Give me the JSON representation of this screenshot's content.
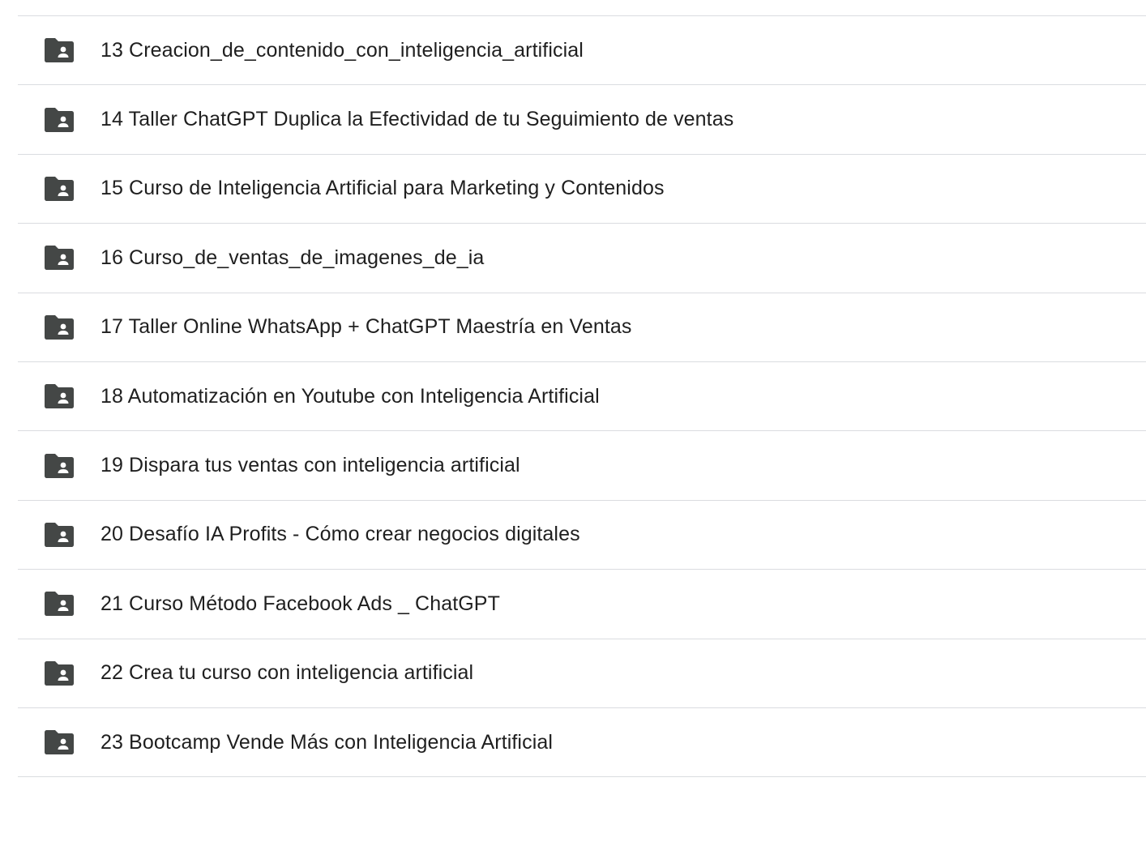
{
  "icons": {
    "folder": "shared-folder-icon"
  },
  "colors": {
    "icon": "#444746",
    "text": "#1f1f1f",
    "divider": "#dadce0"
  },
  "folders": [
    {
      "name": "13 Creacion_de_contenido_con_inteligencia_artificial"
    },
    {
      "name": "14 Taller ChatGPT Duplica la Efectividad de tu Seguimiento de ventas"
    },
    {
      "name": "15 Curso de Inteligencia Artificial para Marketing y Contenidos"
    },
    {
      "name": "16 Curso_de_ventas_de_imagenes_de_ia"
    },
    {
      "name": "17 Taller Online WhatsApp + ChatGPT Maestría en Ventas"
    },
    {
      "name": "18 Automatización en Youtube con Inteligencia Artificial"
    },
    {
      "name": "19 Dispara tus ventas con inteligencia artificial"
    },
    {
      "name": "20 Desafío IA Profits - Cómo crear negocios digitales"
    },
    {
      "name": "21 Curso Método Facebook Ads _ ChatGPT"
    },
    {
      "name": "22 Crea tu curso con inteligencia artificial"
    },
    {
      "name": "23 Bootcamp Vende Más con Inteligencia Artificial"
    }
  ]
}
